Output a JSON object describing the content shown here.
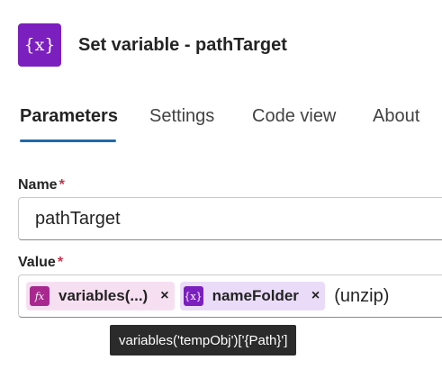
{
  "header": {
    "icon": "variable-icon",
    "icon_glyph": "{x}",
    "title": "Set variable - pathTarget"
  },
  "tabs": [
    {
      "label": "Parameters",
      "active": true
    },
    {
      "label": "Settings",
      "active": false
    },
    {
      "label": "Code view",
      "active": false
    },
    {
      "label": "About",
      "active": false
    }
  ],
  "fields": {
    "name": {
      "label": "Name",
      "required_mark": "*",
      "value": "pathTarget"
    },
    "value": {
      "label": "Value",
      "required_mark": "*",
      "tokens": [
        {
          "type": "expression",
          "icon": "function-icon",
          "icon_glyph": "fx",
          "label": "variables(...)",
          "remove_glyph": "×"
        },
        {
          "type": "variable",
          "icon": "variable-icon",
          "icon_glyph": "{x}",
          "label": "nameFolder",
          "remove_glyph": "×"
        }
      ],
      "literal": "(unzip)"
    }
  },
  "tooltip": {
    "text": "variables('tempObj')['{Path}']"
  },
  "colors": {
    "variable_purple": "#7b1fbf",
    "expression_magenta": "#a8288f",
    "tab_underline": "#1f6aa9",
    "required_red": "#c4314b"
  }
}
